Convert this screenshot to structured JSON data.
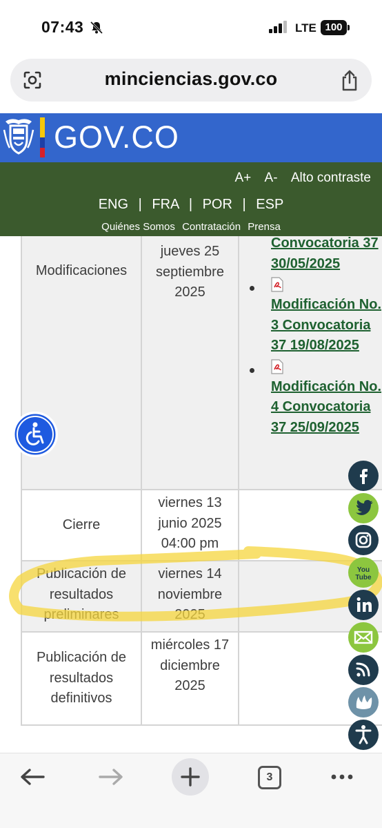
{
  "status_bar": {
    "time": "07:43",
    "network": "LTE",
    "battery": "100"
  },
  "browser": {
    "url": "minciencias.gov.co",
    "tab_count": "3"
  },
  "header": {
    "gov_logo": "GOV.CO",
    "accessibility": {
      "increase_text": "A+",
      "decrease_text": "A-",
      "high_contrast": "Alto contraste"
    },
    "languages": [
      "ENG",
      "FRA",
      "POR",
      "ESP"
    ],
    "language_separator": "|",
    "nav": [
      "Quiénes Somos",
      "Contratación",
      "Prensa"
    ]
  },
  "table": {
    "rows": [
      {
        "stage": "Modificaciones",
        "date": "jueves 25 septiembre 2025",
        "documents": [
          "Convocatoria 37 30/05/2025",
          "Modificación No. 3 Convocatoria 37 19/08/2025",
          "Modificación No. 4 Convocatoria 37 25/09/2025"
        ]
      },
      {
        "stage": "Cierre",
        "date": "viernes 13 junio 2025 04:00 pm"
      },
      {
        "stage": "Publicación de resultados preliminares",
        "date": "viernes 14 noviembre 2025"
      },
      {
        "stage": "Publicación de resultados definitivos",
        "date": "miércoles 17 diciembre 2025"
      }
    ]
  },
  "social": {
    "icons": [
      "facebook-icon",
      "twitter-icon",
      "instagram-icon",
      "youtube-icon",
      "linkedin-icon",
      "email-icon",
      "rss-icon",
      "flickr-icon",
      "accessibility-icon"
    ],
    "youtube_label": "You Tube"
  },
  "colors": {
    "gov_blue": "#3366cc",
    "header_green": "#3b5a2d",
    "link_green": "#1e6130",
    "social_green": "#8cc63f",
    "social_navy": "#1f3b4d",
    "highlighter_yellow": "#f5d63d"
  }
}
